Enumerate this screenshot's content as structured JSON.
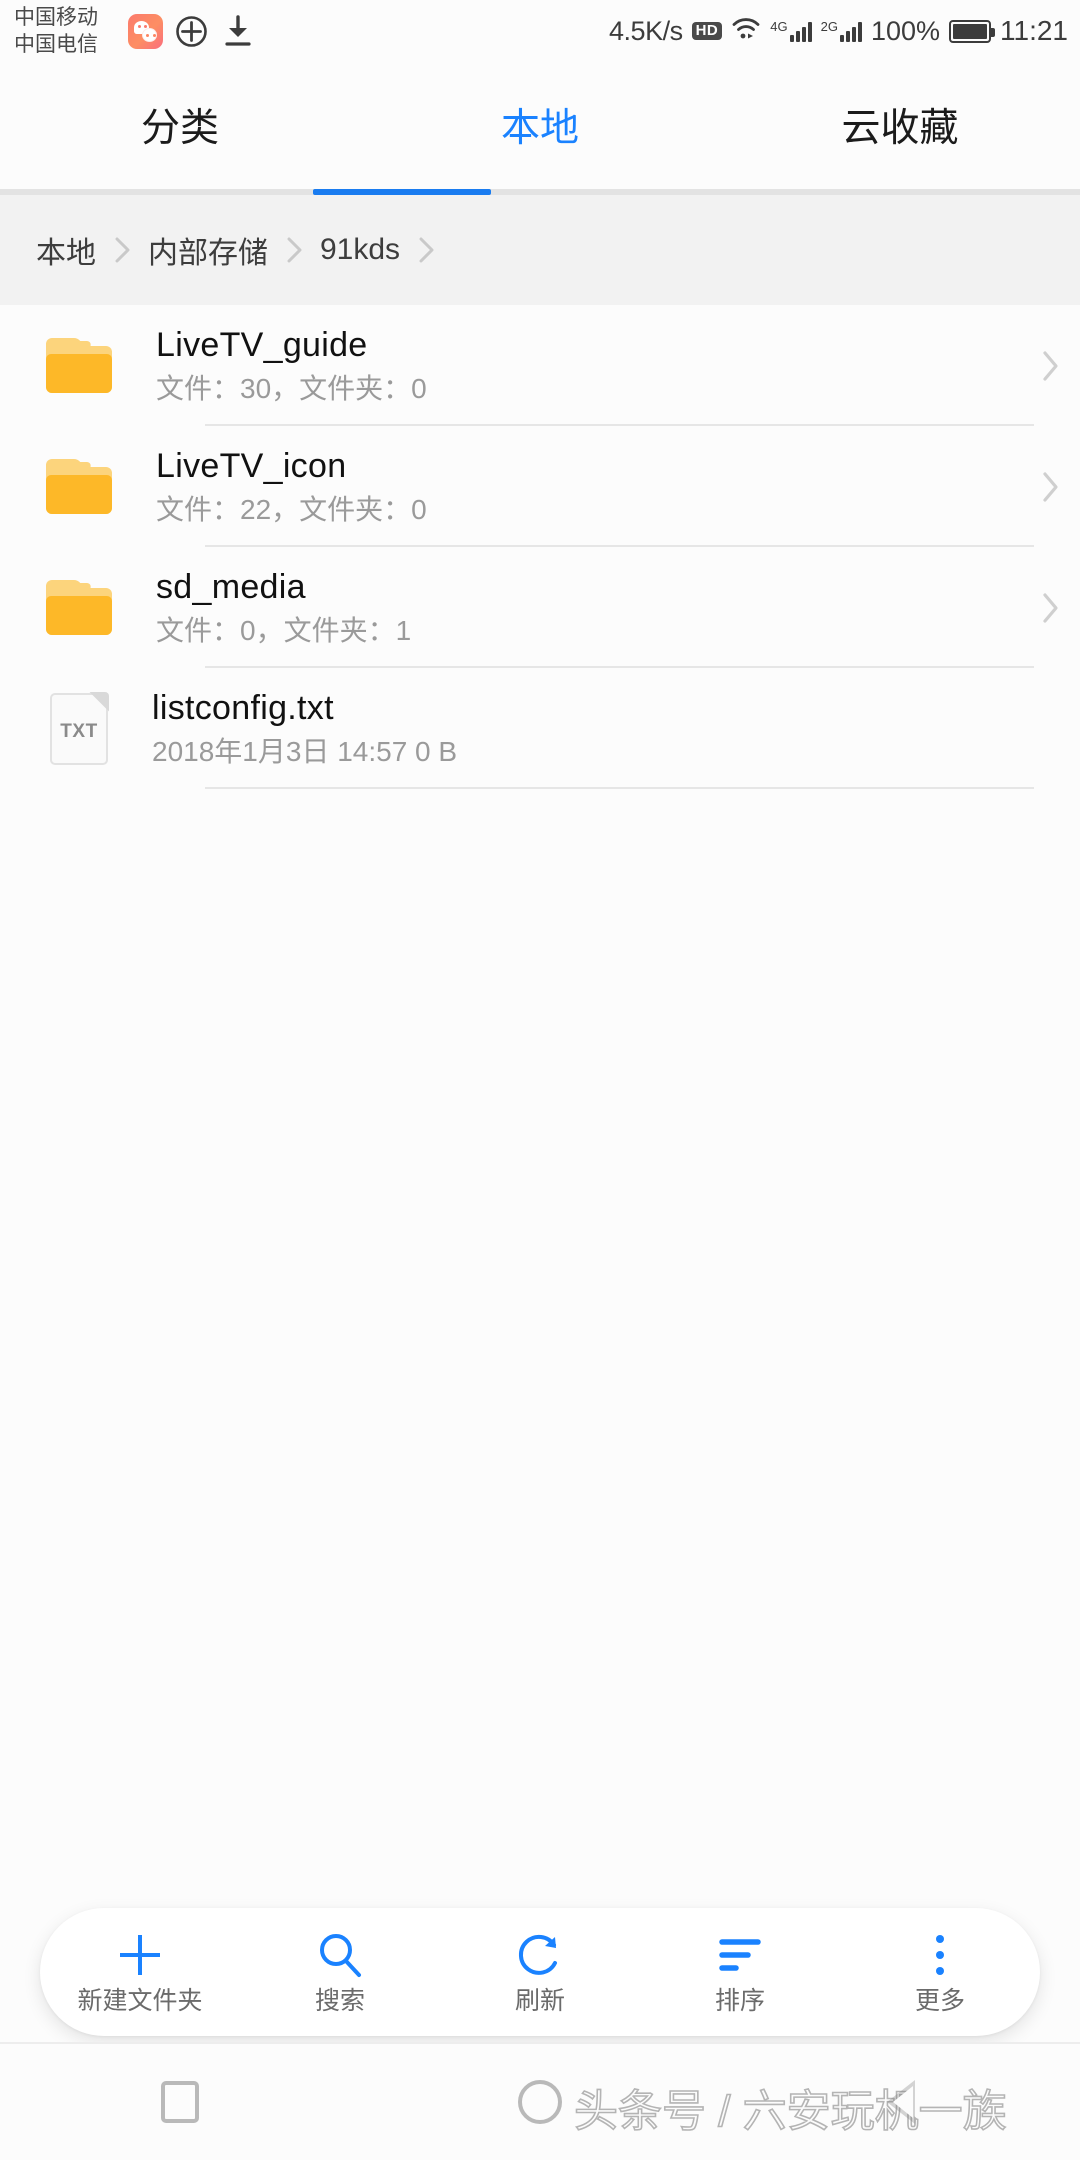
{
  "status_bar": {
    "carrier_line1": "中国移动",
    "carrier_line2": "中国电信",
    "net_speed": "4.5K/s",
    "hd_badge": "HD",
    "signal1_label": "4G",
    "signal2_label": "2G",
    "battery_percent": "100%",
    "clock": "11:21",
    "icons": [
      "wechat-icon",
      "plus-circle-icon",
      "download-icon",
      "wifi-icon",
      "battery-icon"
    ]
  },
  "tabs": [
    {
      "label": "分类",
      "active": false
    },
    {
      "label": "本地",
      "active": true
    },
    {
      "label": "云收藏",
      "active": false
    }
  ],
  "breadcrumb": {
    "items": [
      "本地",
      "内部存储",
      "91kds"
    ],
    "trailing_separator": true
  },
  "files": [
    {
      "name": "LiveTV_guide",
      "meta": "文件：30，文件夹：0",
      "type": "folder",
      "icon": "folder-icon",
      "chevron": true
    },
    {
      "name": "LiveTV_icon",
      "meta": "文件：22，文件夹：0",
      "type": "folder",
      "icon": "folder-icon",
      "chevron": true
    },
    {
      "name": "sd_media",
      "meta": "文件：0，文件夹：1",
      "type": "folder",
      "icon": "folder-icon",
      "chevron": true
    },
    {
      "name": "listconfig.txt",
      "meta": "2018年1月3日 14:57 0 B",
      "type": "file",
      "icon": "txt-file-icon",
      "icon_label": "TXT",
      "chevron": false
    }
  ],
  "toolbar": [
    {
      "label": "新建文件夹",
      "icon": "plus-icon"
    },
    {
      "label": "搜索",
      "icon": "search-icon"
    },
    {
      "label": "刷新",
      "icon": "refresh-icon"
    },
    {
      "label": "排序",
      "icon": "sort-icon"
    },
    {
      "label": "更多",
      "icon": "more-vertical-icon"
    }
  ],
  "nav_bar": {
    "recents_label": "recents-square-icon",
    "home_label": "home-circle-icon",
    "back_label": "back-triangle-icon"
  },
  "watermark": "头条号 / 六安玩机一族",
  "colors": {
    "accent": "#1a82ff",
    "tab_underline": "#1a7cf0",
    "folder_front": "#fdb828",
    "folder_back": "#fcd47c",
    "page_bg": "#fcfcfc",
    "breadcrumb_bg": "#f2f2f2",
    "divider": "#e6e6e6",
    "sub_text": "#9a9a9a"
  }
}
